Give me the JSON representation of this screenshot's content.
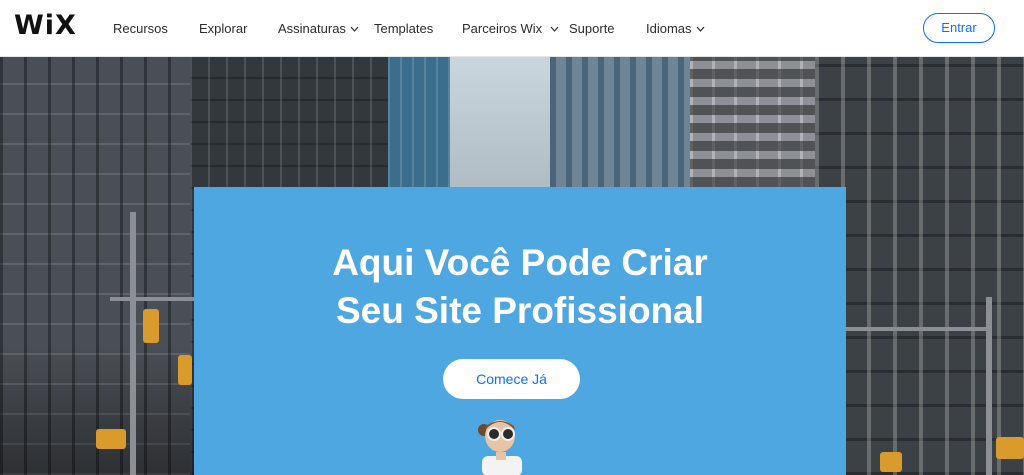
{
  "header": {
    "logo_text": "WiX",
    "nav": [
      {
        "label": "Recursos",
        "has_dropdown": false
      },
      {
        "label": "Explorar",
        "has_dropdown": false
      },
      {
        "label": "Assinaturas",
        "has_dropdown": true
      },
      {
        "label": "Templates",
        "has_dropdown": false
      },
      {
        "label": "Parceiros Wix",
        "has_dropdown": true
      },
      {
        "label": "Suporte",
        "has_dropdown": false
      },
      {
        "label": "Idiomas",
        "has_dropdown": true
      }
    ],
    "login_label": "Entrar"
  },
  "hero": {
    "headline_line1": "Aqui Você Pode Criar",
    "headline_line2": "Seu Site Profissional",
    "cta_label": "Comece Já"
  },
  "colors": {
    "accent": "#116dff",
    "card_blue": "#4fa7e2"
  }
}
